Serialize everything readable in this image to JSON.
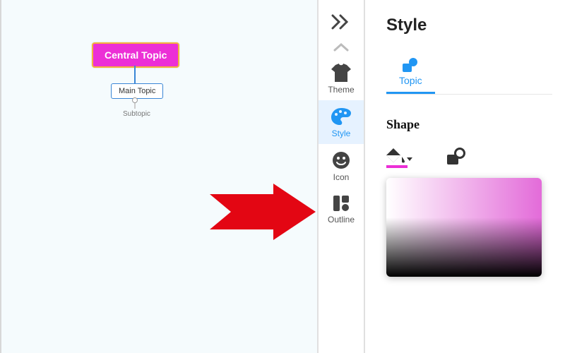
{
  "canvas": {
    "central_topic": "Central Topic",
    "main_topic": "Main Topic",
    "subtopic": "Subtopic"
  },
  "ribbon": {
    "theme": "Theme",
    "style": "Style",
    "icon": "Icon",
    "outline": "Outline"
  },
  "panel": {
    "title": "Style",
    "tab_topic": "Topic",
    "section_shape": "Shape"
  },
  "colors": {
    "accent": "#2196f3",
    "topic_fill": "#ec2fd6"
  }
}
